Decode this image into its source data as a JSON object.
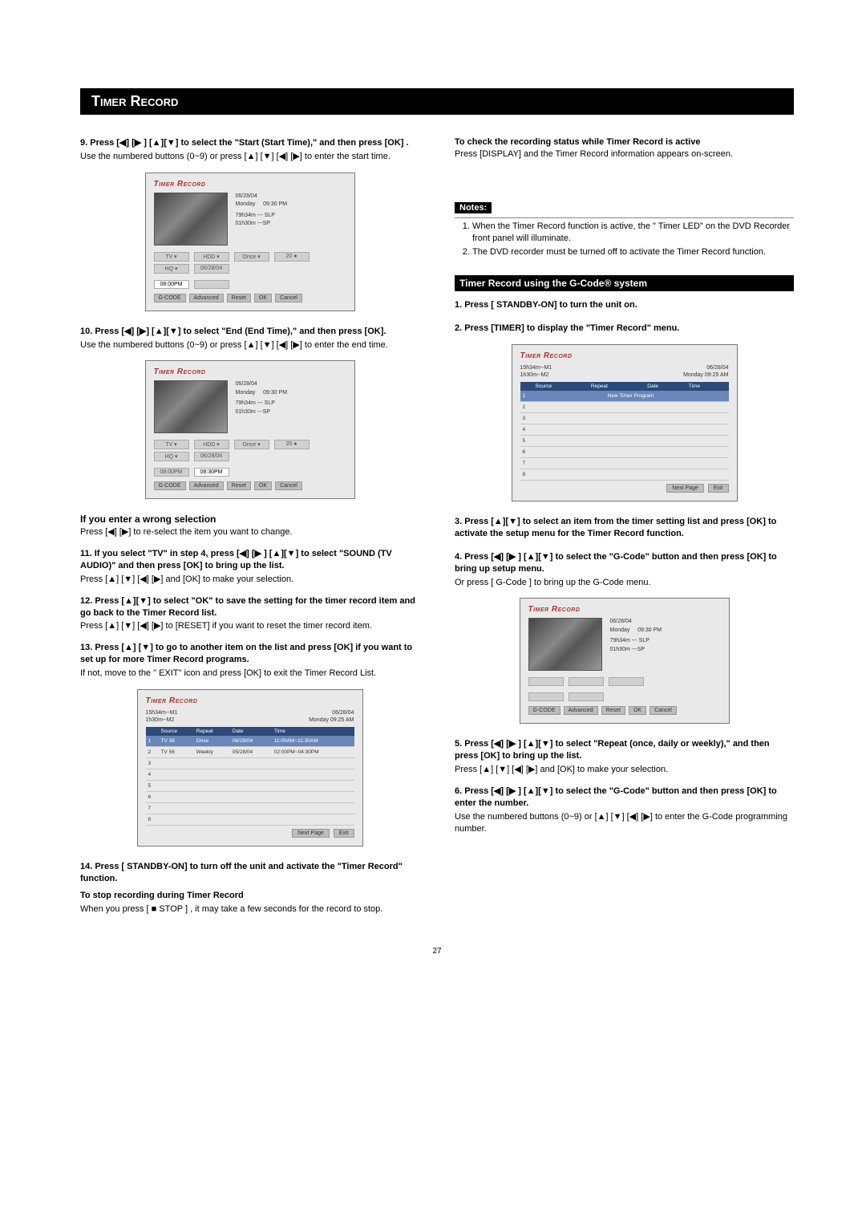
{
  "title": "Timer Record",
  "page_number": "27",
  "left": {
    "step9_heading": "9.  Press [◀] [▶ ] [▲][▼] to select the \"Start (Start Time),\" and then press [OK] .",
    "step9_body": "Use the numbered buttons (0~9) or press [▲] [▼] [◀] [▶] to enter the start time.",
    "step10_heading": "10. Press [◀] [▶] [▲][▼] to select \"End (End Time),\" and then press [OK].",
    "step10_body": "Use the numbered buttons (0~9) or press [▲] [▼] [◀] [▶] to enter the end time.",
    "wrong_heading": "If you enter a wrong selection",
    "wrong_body": "Press [◀] [▶]  to re-select the item you want to change.",
    "step11_heading": "11. If you select \"TV\" in step 4, press [◀] [▶ ] [▲][▼] to select \"SOUND (TV AUDIO)\" and then press [OK] to bring up the list.",
    "step11_body": "Press [▲] [▼] [◀] [▶] and [OK] to make your selection.",
    "step12_heading": "12. Press [▲][▼] to select \"OK\" to save the setting for the timer record item and go back  to the Timer Record list.",
    "step12_body": "Press [▲] [▼] [◀] [▶] to [RESET] if you want to reset the timer record item.",
    "step13_heading": "13. Press [▲] [▼] to go to another item on the list and press [OK] if you want to set up for more Timer Record programs.",
    "step13_body": "If not, move to the \" EXIT\"  icon and press [OK] to exit the Timer Record List.",
    "step14_heading_l1": "14. Press [ STANDBY-ON] to turn off the unit and activate the \"Timer Record\" function.",
    "step14_heading_l2": "To stop recording during Timer Record",
    "step14_body": "When you press [  ■ STOP ] , it may take a few seconds for the record to stop."
  },
  "right": {
    "check_heading": "To check the recording status while Timer Record is active",
    "check_body": "Press [DISPLAY] and the Timer Record information appears on-screen.",
    "notes_label": "Notes:",
    "note1": "When the Timer Record function is active, the \" Timer LED\"  on the DVD Recorder front panel will illuminate.",
    "note2": "The DVD recorder must be turned off to activate the Timer Record function.",
    "gcode_banner": "Timer Record using the G-Code® system",
    "step1_heading": "1.  Press [ STANDBY-ON] to turn the unit on.",
    "step2_heading": "2.  Press [TIMER] to display the \"Timer Record\" menu.",
    "step3_heading": "3.  Press [▲][▼]  to select an item from the timer setting list and press [OK] to activate the setup menu for the Timer Record function.",
    "step4_heading": "4.  Press [◀] [▶ ] [▲][▼] to select the \"G-Code\" button and then press [OK] to bring up setup menu.",
    "step4_body": "Or press [ G-Code ] to bring up the G-Code menu.",
    "step5_heading": "5.  Press [◀] [▶ ] [▲][▼] to select \"Repeat (once, daily or weekly),\" and then press [OK] to bring up the list.",
    "step5_body": "Press [▲] [▼] [◀] [▶] and [OK] to make your selection.",
    "step6_heading": "6.  Press [◀] [▶ ] [▲][▼] to select the \"G-Code\" button and then press [OK] to enter the number.",
    "step6_body": "Use the numbered buttons (0~9) or [▲] [▼] [◀] [▶] to enter the G-Code programming number."
  },
  "shots": {
    "title": "Timer Record",
    "date": "06/28/04",
    "day": "Monday",
    "time_a": "09:30 PM",
    "cap1": "79h34m --- SLP",
    "cap2": "01h30m ---SP",
    "source_tv": "TV ▾",
    "source_ch": "20  ●",
    "hdd": "HDD ▾",
    "hq": "HQ   ▾",
    "once": "Once  ▾",
    "date_box": "06/28/04",
    "start_0800pm": "08:00PM",
    "end_blank": "",
    "start_grey": "08:00PM",
    "end_0830pm": "08:30PM",
    "f_gcode": "G-CODE",
    "f_adv": "Advanced",
    "f_reset": "Reset",
    "f_ok": "OK",
    "f_cancel": "Cancel",
    "m1": "15h34m--M1",
    "m2": "1h30m--M2",
    "date2": "06/28/04",
    "day2": "Monday  09:25 AM",
    "th_source": "Source",
    "th_repeat": "Repeat",
    "th_date": "Date",
    "th_time": "Time",
    "r1_src": "TV 36",
    "r1_rep": "Once",
    "r1_date": "06/28/04",
    "r1_time": "11:00AM~11:30AM",
    "r2_src": "TV 56",
    "r2_rep": "Weekly",
    "r2_date": "05/28/04",
    "r2_time": "02:00PM~04:30PM",
    "new_timer_prog": "New Timer Program",
    "next_page": "Next Page",
    "exit": "Exit"
  }
}
